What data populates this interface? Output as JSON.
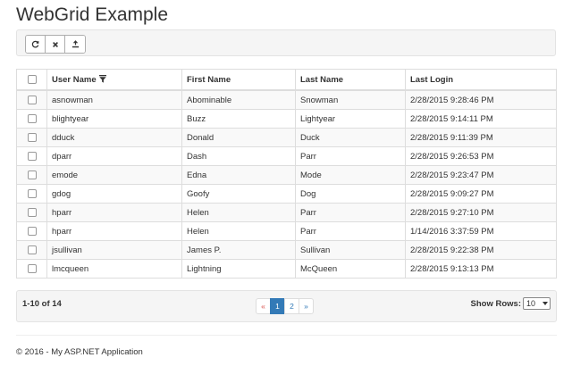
{
  "page": {
    "title": "WebGrid Example"
  },
  "toolbar": {
    "buttons": [
      {
        "icon": "refresh-icon"
      },
      {
        "icon": "clear-icon"
      },
      {
        "icon": "export-icon"
      }
    ]
  },
  "grid": {
    "columns": [
      "User Name",
      "First Name",
      "Last Name",
      "Last Login"
    ],
    "filter_icon": "filter-icon",
    "rows": [
      {
        "user": "asnowman",
        "first": "Abominable",
        "last": "Snowman",
        "login": "2/28/2015 9:28:46 PM"
      },
      {
        "user": "blightyear",
        "first": "Buzz",
        "last": "Lightyear",
        "login": "2/28/2015 9:14:11 PM"
      },
      {
        "user": "dduck",
        "first": "Donald",
        "last": "Duck",
        "login": "2/28/2015 9:11:39 PM"
      },
      {
        "user": "dparr",
        "first": "Dash",
        "last": "Parr",
        "login": "2/28/2015 9:26:53 PM"
      },
      {
        "user": "emode",
        "first": "Edna",
        "last": "Mode",
        "login": "2/28/2015 9:23:47 PM"
      },
      {
        "user": "gdog",
        "first": "Goofy",
        "last": "Dog",
        "login": "2/28/2015 9:09:27 PM"
      },
      {
        "user": "hparr",
        "first": "Helen",
        "last": "Parr",
        "login": "2/28/2015 9:27:10 PM"
      },
      {
        "user": "hparr",
        "first": "Helen",
        "last": "Parr",
        "login": "1/14/2016 3:37:59 PM"
      },
      {
        "user": "jsullivan",
        "first": "James P.",
        "last": "Sullivan",
        "login": "2/28/2015 9:22:38 PM"
      },
      {
        "user": "lmcqueen",
        "first": "Lightning",
        "last": "McQueen",
        "login": "2/28/2015 9:13:13 PM"
      }
    ]
  },
  "pager": {
    "summary": "1-10 of 14",
    "prev_label": "«",
    "pages": [
      "1",
      "2"
    ],
    "active_page": "1",
    "next_label": "»",
    "show_rows_label": "Show Rows:",
    "rows_value": "10"
  },
  "footer": {
    "text": "© 2016 - My ASP.NET Application"
  },
  "colors": {
    "accent": "#337ab7",
    "prev_arrow": "#d9534f",
    "panel_bg": "#f5f5f5",
    "stripe": "#f9f9f9"
  }
}
